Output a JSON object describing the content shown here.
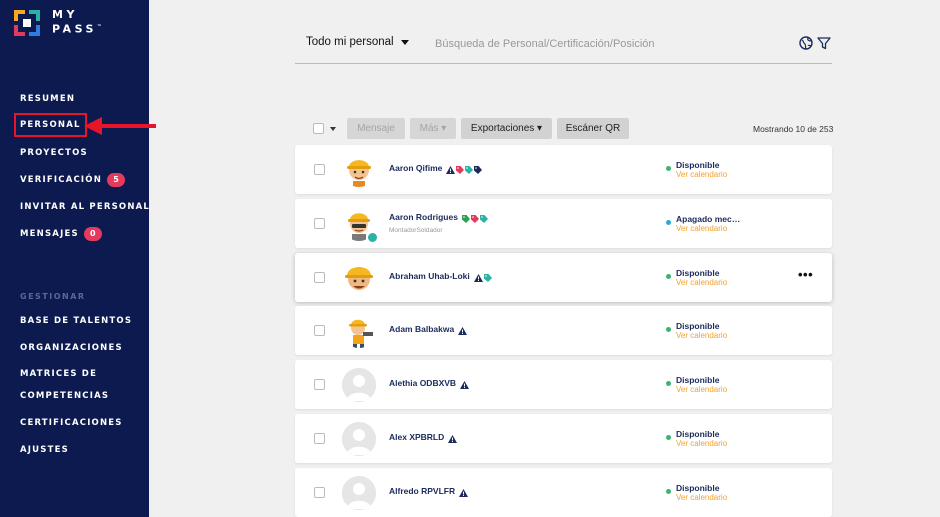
{
  "brand": {
    "name_line1": "MY",
    "name_line2": "PASS",
    "trademark": "™"
  },
  "sidebar": {
    "items": [
      {
        "label": "RESUMEN",
        "badge": null
      },
      {
        "label": "PERSONAL",
        "badge": null,
        "active": true
      },
      {
        "label": "PROYECTOS",
        "badge": null
      },
      {
        "label": "VERIFICACIÓN",
        "badge": "5"
      },
      {
        "label": "INVITAR AL PERSONAL",
        "badge": null
      },
      {
        "label": "MENSAJES",
        "badge": "0"
      }
    ],
    "section_label": "GESTIONAR",
    "manage_items": [
      {
        "label": "BASE DE TALENTOS"
      },
      {
        "label": "ORGANIZACIONES"
      },
      {
        "label": "MATRICES DE"
      },
      {
        "label": "COMPETENCIAS"
      },
      {
        "label": "CERTIFICACIONES"
      },
      {
        "label": "AJUSTES"
      }
    ]
  },
  "topbar": {
    "scope_label": "Todo mi personal",
    "search_placeholder": "Búsqueda de Personal/Certificación/Posición"
  },
  "toolbar": {
    "message_label": "Mensaje",
    "more_label": "Más ▾",
    "exports_label": "Exportaciones ▾",
    "qr_label": "Escáner QR",
    "showing_text": "Mostrando 10 de 253"
  },
  "calendar_label": "Ver calendario",
  "rows": [
    {
      "name": "Aaron Qifime",
      "subtitle": "",
      "status": "Disponible",
      "status_color": "#3cb371",
      "avatar": "worker1",
      "icons": [
        "warn",
        "tag-red",
        "tag-teal",
        "tag-navy"
      ]
    },
    {
      "name": "Aaron Rodrigues",
      "subtitle": "MontadorSoldador",
      "status": "Apagado mec…",
      "status_color": "#29a9d8",
      "avatar": "worker2",
      "icons": [
        "tag-green",
        "tag-red",
        "tag-teal"
      ],
      "verified": true
    },
    {
      "name": "Abraham Uhab-Loki",
      "subtitle": "",
      "status": "Disponible",
      "status_color": "#3cb371",
      "avatar": "worker3",
      "icons": [
        "warn",
        "tag-teal"
      ],
      "more": "•••"
    },
    {
      "name": "Adam Balbakwa",
      "subtitle": "",
      "status": "Disponible",
      "status_color": "#3cb371",
      "avatar": "worker4",
      "icons": [
        "warn"
      ]
    },
    {
      "name": "Alethia ODBXVB",
      "subtitle": "",
      "status": "Disponible",
      "status_color": "#3cb371",
      "avatar": "blank",
      "icons": [
        "warn"
      ]
    },
    {
      "name": "Alex XPBRLD",
      "subtitle": "",
      "status": "Disponible",
      "status_color": "#3cb371",
      "avatar": "blank",
      "icons": [
        "warn"
      ]
    },
    {
      "name": "Alfredo RPVLFR",
      "subtitle": "",
      "status": "Disponible",
      "status_color": "#3cb371",
      "avatar": "blank",
      "icons": [
        "warn"
      ]
    }
  ],
  "colors": {
    "sidebar_bg": "#0c1a4f",
    "badge": "#e23b5e",
    "accent_orange": "#f2a12d",
    "highlight_red": "#e8152a"
  }
}
